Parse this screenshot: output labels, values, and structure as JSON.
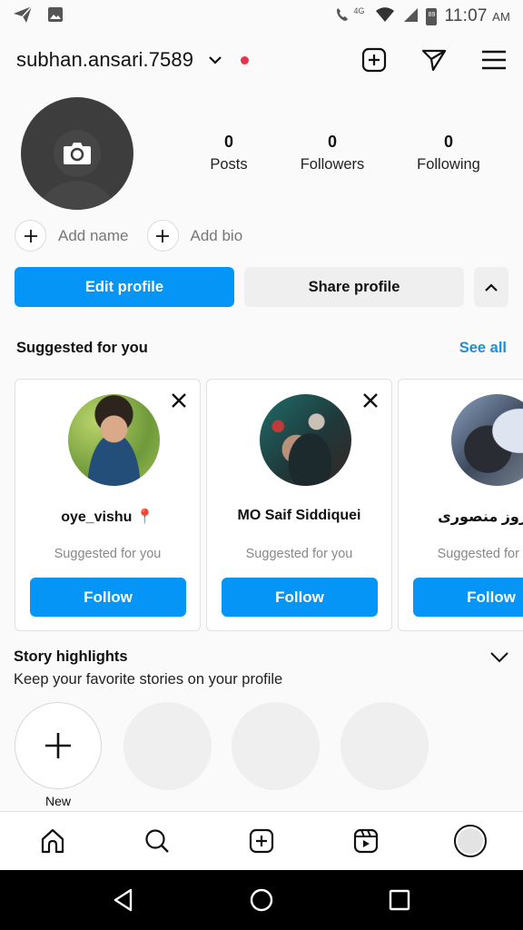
{
  "status_bar": {
    "left_icons": [
      "telegram-icon",
      "gallery-icon"
    ],
    "network": "4G",
    "battery_level": "89",
    "time": "11:07",
    "ampm": "AM"
  },
  "header": {
    "username": "subhan.ansari.7589",
    "notification_dot_color": "#e8334a",
    "actions": [
      "new-post-icon",
      "direct-message-icon",
      "menu-icon"
    ]
  },
  "profile": {
    "stats": [
      {
        "value": "0",
        "label": "Posts"
      },
      {
        "value": "0",
        "label": "Followers"
      },
      {
        "value": "0",
        "label": "Following"
      }
    ],
    "add_name_label": "Add name",
    "add_bio_label": "Add bio"
  },
  "buttons": {
    "edit_profile": "Edit profile",
    "share_profile": "Share profile",
    "primary_color": "#0495f6"
  },
  "suggested": {
    "title": "Suggested for you",
    "see_all": "See all",
    "cards": [
      {
        "name": "oye_vishu 📍",
        "subtitle": "Suggested for you",
        "follow_label": "Follow"
      },
      {
        "name": "MO Saif Siddiquei",
        "subtitle": "Suggested for you",
        "follow_label": "Follow"
      },
      {
        "name": "فیروز منصوری",
        "subtitle": "Suggested for you",
        "follow_label": "Follow"
      }
    ]
  },
  "story_highlights": {
    "title": "Story highlights",
    "subtitle": "Keep your favorite stories on your profile",
    "new_label": "New"
  },
  "bottom_nav": {
    "items": [
      "home-icon",
      "search-icon",
      "create-icon",
      "reels-icon",
      "profile-avatar"
    ]
  },
  "system_nav": {
    "items": [
      "back-icon",
      "home-circle-icon",
      "recents-icon"
    ]
  }
}
